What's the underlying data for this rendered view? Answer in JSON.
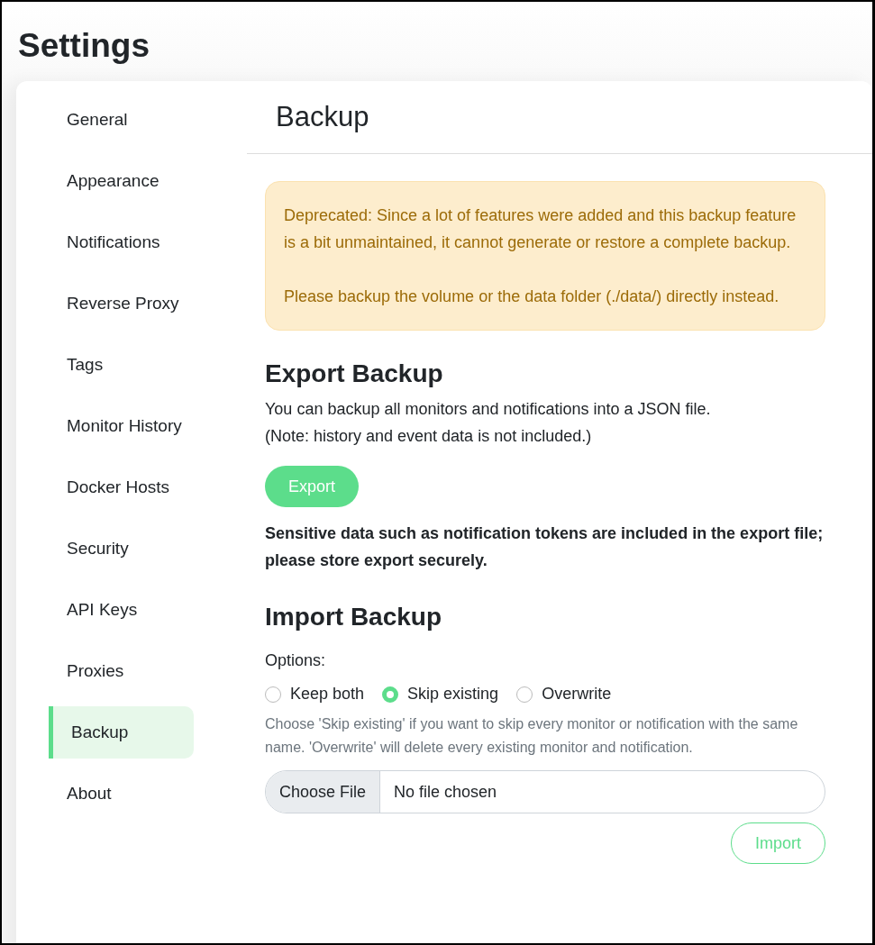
{
  "page_title": "Settings",
  "sidebar": {
    "items": [
      {
        "label": "General",
        "selected": false
      },
      {
        "label": "Appearance",
        "selected": false
      },
      {
        "label": "Notifications",
        "selected": false
      },
      {
        "label": "Reverse Proxy",
        "selected": false
      },
      {
        "label": "Tags",
        "selected": false
      },
      {
        "label": "Monitor History",
        "selected": false
      },
      {
        "label": "Docker Hosts",
        "selected": false
      },
      {
        "label": "Security",
        "selected": false
      },
      {
        "label": "API Keys",
        "selected": false
      },
      {
        "label": "Proxies",
        "selected": false
      },
      {
        "label": "Backup",
        "selected": true
      },
      {
        "label": "About",
        "selected": false
      }
    ]
  },
  "section_title": "Backup",
  "warning": {
    "paragraphs": [
      "Deprecated: Since a lot of features were added and this backup feature is a bit unmaintained, it cannot generate or restore a complete backup.",
      "Please backup the volume or the data folder (./data/) directly instead."
    ]
  },
  "export": {
    "heading": "Export Backup",
    "description": [
      "You can backup all monitors and notifications into a JSON file.",
      "(Note: history and event data is not included.)"
    ],
    "button": "Export",
    "notice": "Sensitive data such as notification tokens are included in the export file; please store export securely."
  },
  "import": {
    "heading": "Import Backup",
    "options_label": "Options:",
    "options": [
      {
        "label": "Keep both",
        "selected": false
      },
      {
        "label": "Skip existing",
        "selected": true
      },
      {
        "label": "Overwrite",
        "selected": false
      }
    ],
    "help": "Choose 'Skip existing' if you want to skip every monitor or notification with the same name. 'Overwrite' will delete every existing monitor and notification.",
    "file_button": "Choose File",
    "file_status": "No file chosen",
    "button": "Import"
  }
}
